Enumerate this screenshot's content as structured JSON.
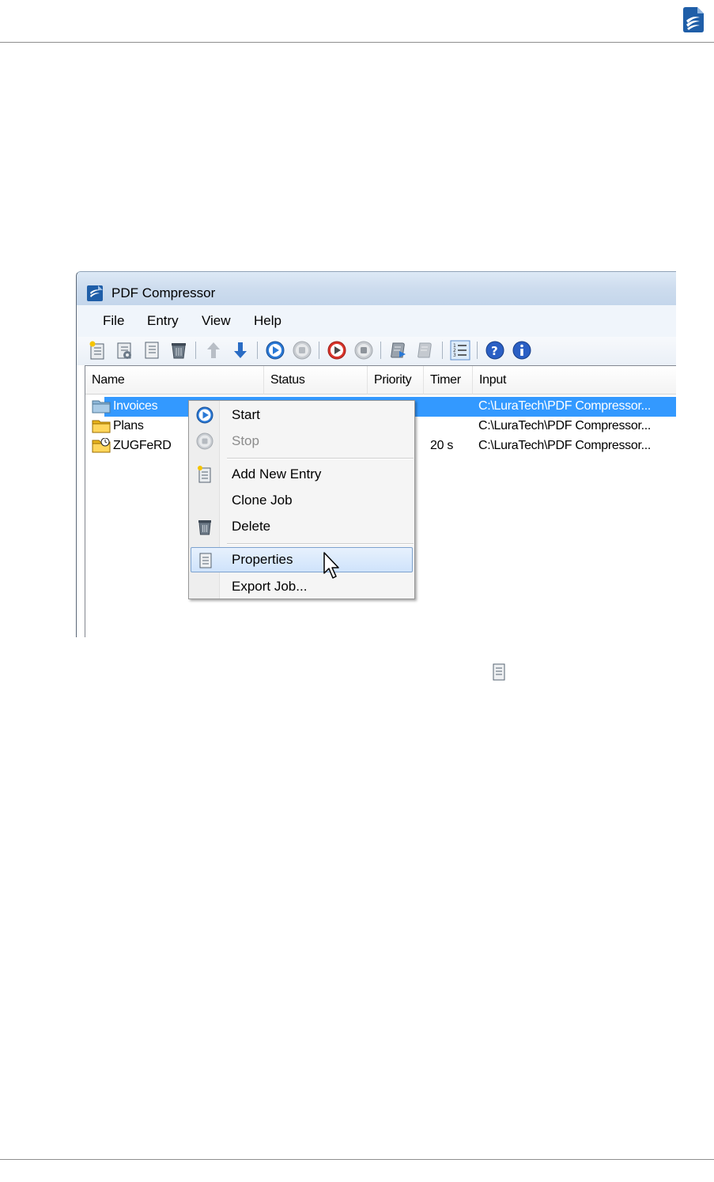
{
  "window": {
    "title": "PDF Compressor",
    "menu": [
      "File",
      "Entry",
      "View",
      "Help"
    ]
  },
  "toolbar": {
    "icons": [
      "add-entry-icon",
      "clone-job-icon",
      "properties-icon",
      "delete-icon",
      "move-up-icon",
      "move-down-icon",
      "start-icon",
      "stop-icon",
      "record-start-icon",
      "record-stop-icon",
      "export-script-icon",
      "import-script-icon",
      "list-view-icon",
      "help-icon",
      "info-icon"
    ]
  },
  "table": {
    "columns": [
      "Name",
      "Status",
      "Priority",
      "Timer",
      "Input"
    ],
    "rows": [
      {
        "name": "Invoices",
        "timer": "",
        "input": "C:\\LuraTech\\PDF Compressor...",
        "selected": true
      },
      {
        "name": "Plans",
        "timer": "",
        "input": "C:\\LuraTech\\PDF Compressor...",
        "selected": false
      },
      {
        "name": "ZUGFeRD",
        "timer": "20 s",
        "input": "C:\\LuraTech\\PDF Compressor...",
        "selected": false
      }
    ]
  },
  "context_menu": {
    "items": [
      {
        "label": "Start",
        "icon": "start-icon",
        "enabled": true
      },
      {
        "label": "Stop",
        "icon": "stop-icon",
        "enabled": false
      },
      {
        "label": "Add New Entry",
        "icon": "add-entry-icon",
        "enabled": true
      },
      {
        "label": "Clone Job",
        "icon": "",
        "enabled": true
      },
      {
        "label": "Delete",
        "icon": "delete-icon",
        "enabled": true
      },
      {
        "label": "Properties",
        "icon": "properties-icon",
        "enabled": true,
        "hovered": true
      },
      {
        "label": "Export Job...",
        "icon": "",
        "enabled": true
      }
    ]
  },
  "colors": {
    "selection": "#3399ff",
    "brand": "#1f5ea8"
  }
}
